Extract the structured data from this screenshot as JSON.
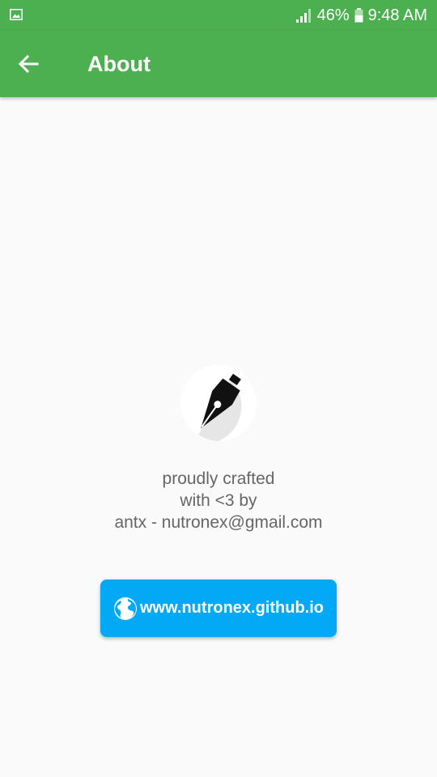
{
  "status_bar": {
    "battery_percent": "46%",
    "time": "9:48 AM",
    "icons": [
      "image-notification-icon",
      "signal-icon",
      "battery-icon"
    ]
  },
  "app_bar": {
    "title": "About",
    "back_icon": "arrow-left-icon"
  },
  "about": {
    "logo_icon": "fountain-pen-nib-icon",
    "credit_lines": [
      "proudly crafted",
      "with <3 by",
      "antx - nutronex@gmail.com"
    ],
    "website_button_label": "www.nutronex.github.io",
    "website_icon": "globe-icon"
  },
  "colors": {
    "primary": "#4caf50",
    "accent": "#03a9f4",
    "background": "#fafafa",
    "text_secondary": "#666666"
  }
}
